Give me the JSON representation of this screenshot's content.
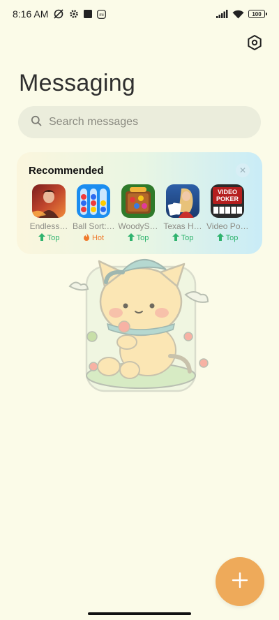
{
  "status_bar": {
    "time": "8:16 AM",
    "battery": "100",
    "icons": [
      "no-alarm-icon",
      "gear-notification-icon",
      "square-app-icon",
      "mi-icon",
      "signal-icon",
      "wifi-icon",
      "battery-icon"
    ]
  },
  "header": {
    "title": "Messaging"
  },
  "search": {
    "placeholder": "Search messages",
    "value": ""
  },
  "recommended": {
    "title": "Recommended",
    "close_icon": "close-icon",
    "apps": [
      {
        "name": "Endless…",
        "badge": "Top",
        "badge_type": "top",
        "icon": "endless-game-icon"
      },
      {
        "name": "Ball Sort:…",
        "badge": "Hot",
        "badge_type": "hot",
        "icon": "ball-sort-icon"
      },
      {
        "name": "WoodyS…",
        "badge": "Top",
        "badge_type": "top",
        "icon": "woody-game-icon"
      },
      {
        "name": "Texas H…",
        "badge": "Top",
        "badge_type": "top",
        "icon": "texas-holdem-icon"
      },
      {
        "name": "Video Po…",
        "badge": "Top",
        "badge_type": "top",
        "icon": "video-poker-icon",
        "icon_text": [
          "VIDEO",
          "POKER"
        ]
      }
    ]
  },
  "illustration": {
    "icon": "cat-illustration"
  },
  "fab": {
    "icon": "plus-icon"
  },
  "colors": {
    "background": "#fbfbe8",
    "search_bg": "#ebeddc",
    "fab": "#eeaa5a",
    "badge_top": "#2fb36e",
    "badge_hot": "#ef7a2c"
  }
}
